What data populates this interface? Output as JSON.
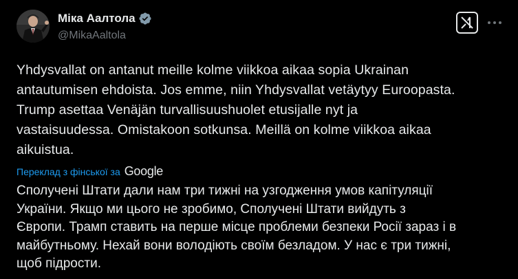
{
  "author": {
    "name": "Міка Аалтола",
    "handle": "@MikaAaltola",
    "verified": true
  },
  "icons": {
    "verified": "verified-badge-icon",
    "grok": "grok-icon",
    "more": "more-options-icon",
    "google": "google-logo"
  },
  "tweet": {
    "original_lines": [
      "Yhdysvallat on antanut meille kolme viikkoa aikaa sopia Ukrainan",
      "antautumisen ehdoista. Jos emme, niin Yhdysvallat vetäytyy Euroopasta.",
      "Trump asettaa Venäjän turvallisuushuolet etusijalle nyt ja",
      "vastaisuudessa. Omistakoon sotkunsa. Meillä on kolme viikkoa aikaa",
      "aikuistua."
    ],
    "translate_label": "Переклад з фінської за",
    "translate_provider": "Google",
    "translated_lines": [
      "Сполучені Штати дали нам три тижні на узгодження умов капітуляції",
      "України. Якщо ми цього не зробимо, Сполучені Штати вийдуть з",
      "Європи. Трамп ставить на перше місце проблеми безпеки Росії зараз і в",
      "майбутньому. Нехай вони володіють своїм безладом. У нас є три тижні,",
      "щоб підрости."
    ]
  },
  "colors": {
    "background": "#000000",
    "text": "#e7e9ea",
    "secondary": "#71767b",
    "link": "#1d9bf0",
    "verified": "#829aab"
  }
}
